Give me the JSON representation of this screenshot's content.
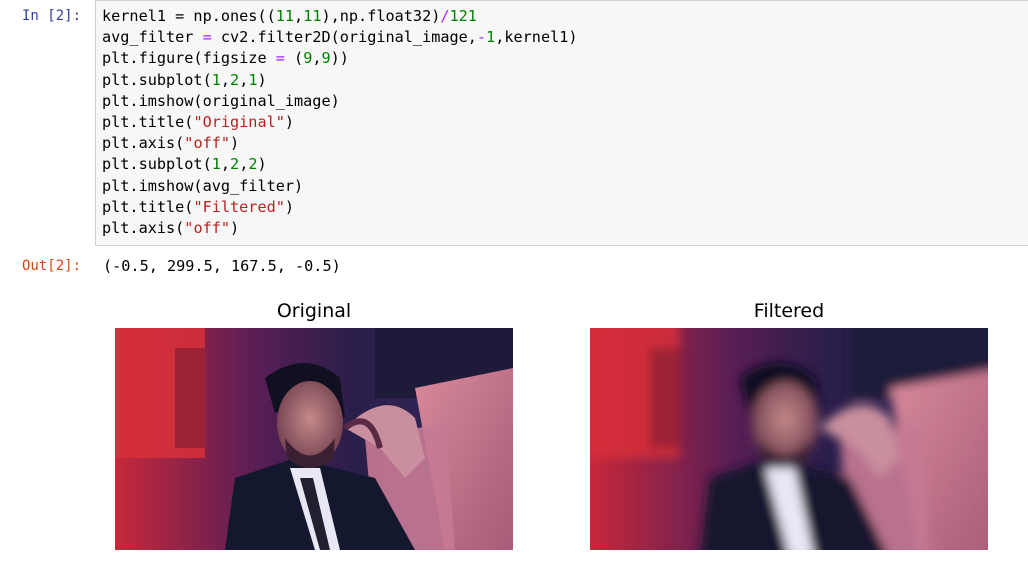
{
  "cell": {
    "in_prompt": "In [2]:",
    "out_prompt": "Out[2]:",
    "lines": [
      [
        {
          "t": "kernel1 = np.ones(("
        },
        {
          "t": "11",
          "c": "num"
        },
        {
          "t": ","
        },
        {
          "t": "11",
          "c": "num"
        },
        {
          "t": "),np.float32)"
        },
        {
          "t": "/",
          "c": "op"
        },
        {
          "t": "121",
          "c": "num"
        }
      ],
      [
        {
          "t": "avg_filter "
        },
        {
          "t": "=",
          "c": "op"
        },
        {
          "t": " cv2.filter2D(original_image,"
        },
        {
          "t": "-",
          "c": "op"
        },
        {
          "t": "1",
          "c": "num"
        },
        {
          "t": ",kernel1)"
        }
      ],
      [
        {
          "t": "plt.figure(figsize "
        },
        {
          "t": "=",
          "c": "op"
        },
        {
          "t": " ("
        },
        {
          "t": "9",
          "c": "num"
        },
        {
          "t": ","
        },
        {
          "t": "9",
          "c": "num"
        },
        {
          "t": "))"
        }
      ],
      [
        {
          "t": "plt.subplot("
        },
        {
          "t": "1",
          "c": "num"
        },
        {
          "t": ","
        },
        {
          "t": "2",
          "c": "num"
        },
        {
          "t": ","
        },
        {
          "t": "1",
          "c": "num"
        },
        {
          "t": ")"
        }
      ],
      [
        {
          "t": "plt.imshow(original_image)"
        }
      ],
      [
        {
          "t": "plt.title("
        },
        {
          "t": "\"Original\"",
          "c": "str"
        },
        {
          "t": ")"
        }
      ],
      [
        {
          "t": "plt.axis("
        },
        {
          "t": "\"off\"",
          "c": "str"
        },
        {
          "t": ")"
        }
      ],
      [
        {
          "t": "plt.subplot("
        },
        {
          "t": "1",
          "c": "num"
        },
        {
          "t": ","
        },
        {
          "t": "2",
          "c": "num"
        },
        {
          "t": ","
        },
        {
          "t": "2",
          "c": "num"
        },
        {
          "t": ")"
        }
      ],
      [
        {
          "t": "plt.imshow(avg_filter)"
        }
      ],
      [
        {
          "t": "plt.title("
        },
        {
          "t": "\"Filtered\"",
          "c": "str"
        },
        {
          "t": ")"
        }
      ],
      [
        {
          "t": "plt.axis("
        },
        {
          "t": "\"off\"",
          "c": "str"
        },
        {
          "t": ")"
        }
      ]
    ],
    "output_text": "(-0.5, 299.5, 167.5, -0.5)"
  },
  "figure": {
    "left_title": "Original",
    "right_title": "Filtered"
  },
  "colors": {
    "in_prompt": "#303f9f",
    "out_prompt": "#d84315",
    "number": "#008000",
    "operator": "#aa22ff",
    "string": "#ba2121"
  }
}
